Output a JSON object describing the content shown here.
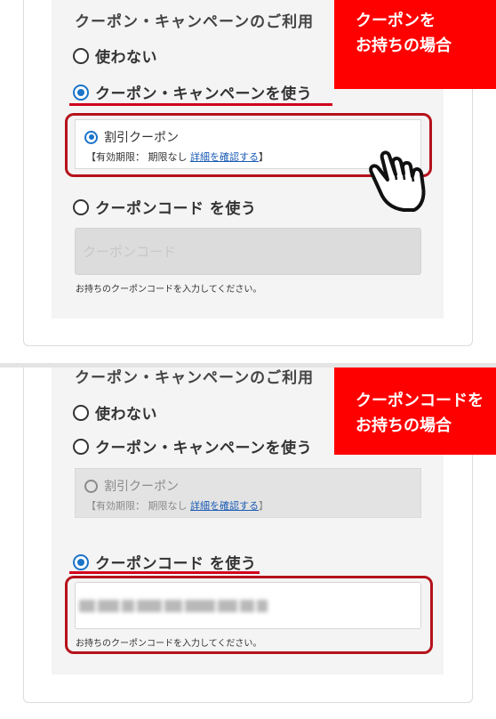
{
  "panel1": {
    "heading": "クーポン・キャンペーンのご利用",
    "option_none": "使わない",
    "option_campaign": "クーポン・キャンペーンを使う",
    "coupon_name": "割引クーポン",
    "coupon_expiry_prefix": "【有効期限： 期限なし",
    "coupon_detail_link": "詳細を確認する",
    "coupon_expiry_suffix": "】",
    "option_code": "クーポンコード を使う",
    "code_placeholder": "クーポンコード",
    "code_helper": "お持ちのクーポンコードを入力してください。",
    "callout_line1": "クーポンを",
    "callout_line2": "お持ちの場合",
    "selected_option": "campaign"
  },
  "panel2": {
    "heading": "クーポン・キャンペーンのご利用",
    "option_none": "使わない",
    "option_campaign": "クーポン・キャンペーンを使う",
    "coupon_name": "割引クーポン",
    "coupon_expiry_prefix": "【有効期限： 期限なし",
    "coupon_detail_link": "詳細を確認する",
    "coupon_expiry_suffix": "】",
    "option_code": "クーポンコード を使う",
    "code_helper": "お持ちのクーポンコードを入力してください。",
    "callout_line1": "クーポンコードを",
    "callout_line2": "お持ちの場合",
    "selected_option": "code"
  },
  "colors": {
    "accent_red": "#d0021b",
    "callout_red": "#ff0000",
    "radio_blue": "#1a73c8",
    "link_blue": "#1a5bb5",
    "panel_gray": "#f4f4f4"
  },
  "icons": [
    "pointing-hand-icon"
  ]
}
